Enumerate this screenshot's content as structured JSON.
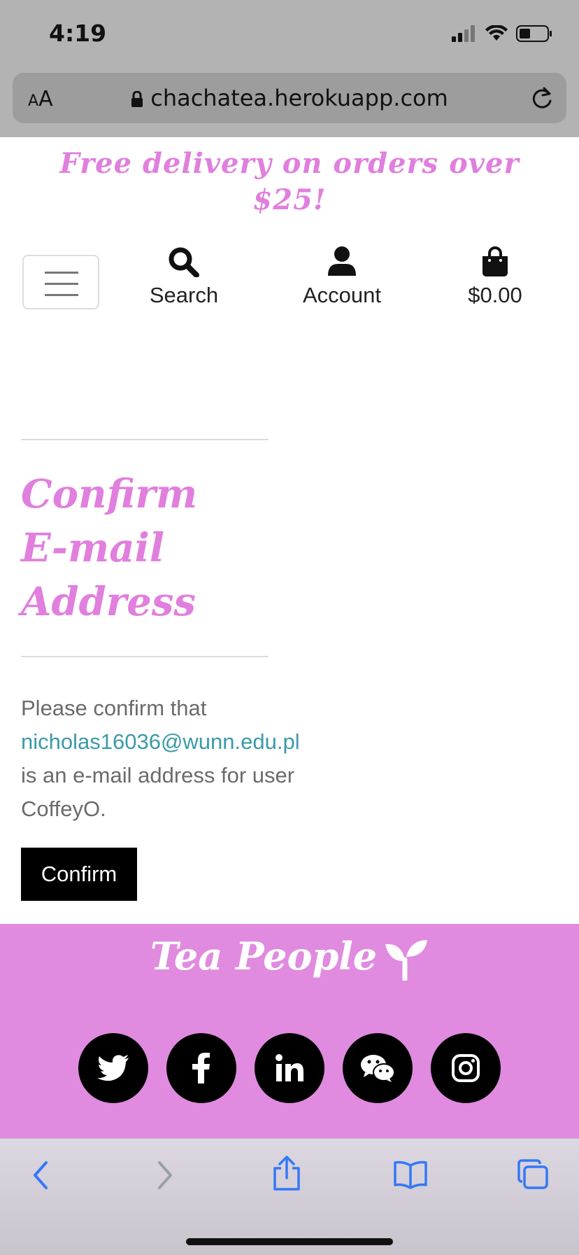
{
  "status_bar": {
    "time": "4:19"
  },
  "browser": {
    "text_size_button": "AA",
    "url": "chachatea.herokuapp.com"
  },
  "promo_banner": "Free delivery on orders over $25!",
  "nav": {
    "search_label": "Search",
    "account_label": "Account",
    "cart_total": "$0.00"
  },
  "page": {
    "title_line1": "Confirm",
    "title_line2": "E-mail",
    "title_line3": "Address",
    "text_before": "Please confirm that",
    "email": "nicholas16036@wunn.edu.pl",
    "text_after": "is an e-mail address for user CoffeyO.",
    "confirm_label": "Confirm"
  },
  "footer": {
    "brand": "Tea People",
    "socials": [
      "twitter-icon",
      "facebook-icon",
      "linkedin-icon",
      "wechat-icon",
      "instagram-icon"
    ]
  },
  "colors": {
    "accent": "#e07fdd",
    "footer_bg": "#e08bdf",
    "link": "#3a9aa8"
  }
}
